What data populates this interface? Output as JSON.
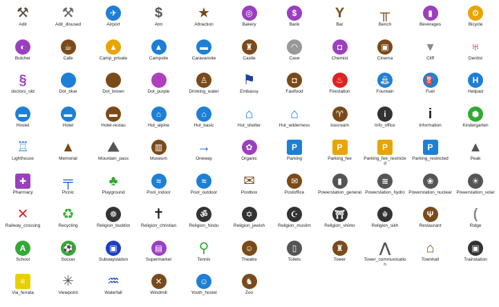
{
  "title": "",
  "icons": [
    {
      "label": "Adit",
      "color": "#5a4a3a",
      "glyph": "⚒",
      "shape": "plain"
    },
    {
      "label": "Adit_disused",
      "color": "#666666",
      "glyph": "⚒",
      "shape": "plain"
    },
    {
      "label": "Airport",
      "color": "#1e7fd6",
      "glyph": "✈",
      "shape": "circle"
    },
    {
      "label": "Atm",
      "color": "#555555",
      "glyph": "$",
      "shape": "plain"
    },
    {
      "label": "Attraction",
      "color": "#7a4a1a",
      "glyph": "★",
      "shape": "plain"
    },
    {
      "label": "Bakery",
      "color": "#9b3fbf",
      "glyph": "◎",
      "shape": "circle"
    },
    {
      "label": "Bank",
      "color": "#9b3fbf",
      "glyph": "$",
      "shape": "circle"
    },
    {
      "label": "Bar",
      "color": "#7a4a1a",
      "glyph": "Y",
      "shape": "plain"
    },
    {
      "label": "Bench",
      "color": "#7a4a1a",
      "glyph": "╥",
      "shape": "plain"
    },
    {
      "label": "Beverages",
      "color": "#9b3fbf",
      "glyph": "▮",
      "shape": "circle"
    },
    {
      "label": "Bicycle",
      "color": "#e8a400",
      "glyph": "⚙",
      "shape": "circle"
    },
    {
      "label": "Butcher",
      "color": "#9b3fbf",
      "glyph": "◐",
      "shape": "circle"
    },
    {
      "label": "Cafe",
      "color": "#7a4a1a",
      "glyph": "☕",
      "shape": "circle"
    },
    {
      "label": "Camp_private",
      "color": "#e8a400",
      "glyph": "▲",
      "shape": "circle"
    },
    {
      "label": "Campsite",
      "color": "#1e7fd6",
      "glyph": "▲",
      "shape": "circle"
    },
    {
      "label": "Caravansite",
      "color": "#1e7fd6",
      "glyph": "▬",
      "shape": "circle"
    },
    {
      "label": "Castle",
      "color": "#7a4a1a",
      "glyph": "♜",
      "shape": "circle"
    },
    {
      "label": "Cave",
      "color": "#999999",
      "glyph": "◠",
      "shape": "circle"
    },
    {
      "label": "Chemist",
      "color": "#9b3fbf",
      "glyph": "◘",
      "shape": "circle"
    },
    {
      "label": "Cinema",
      "color": "#7a4a1a",
      "glyph": "▣",
      "shape": "circle"
    },
    {
      "label": "Cliff",
      "color": "#888888",
      "glyph": "▾",
      "shape": "plain"
    },
    {
      "label": "Dentist",
      "color": "#cc2255",
      "glyph": "♅",
      "shape": "plain"
    },
    {
      "label": "doctors_old",
      "color": "#9b3fbf",
      "glyph": "§",
      "shape": "plain"
    },
    {
      "label": "Dot_blue",
      "color": "#1e7fd6",
      "glyph": "",
      "shape": "circle"
    },
    {
      "label": "Dot_brown",
      "color": "#7a4a1a",
      "glyph": "",
      "shape": "circle"
    },
    {
      "label": "Dot_purple",
      "color": "#b03fbf",
      "glyph": "",
      "shape": "circle"
    },
    {
      "label": "Drinking_water",
      "color": "#7a4a1a",
      "glyph": "♙",
      "shape": "circle"
    },
    {
      "label": "Embassy",
      "color": "#1e3f9f",
      "glyph": "⚑",
      "shape": "plain"
    },
    {
      "label": "Fastfood",
      "color": "#7a4a1a",
      "glyph": "◘",
      "shape": "circle"
    },
    {
      "label": "Firestation",
      "color": "#dd2222",
      "glyph": "♨",
      "shape": "circle"
    },
    {
      "label": "Fountain",
      "color": "#1e7fd6",
      "glyph": "⛲",
      "shape": "circle"
    },
    {
      "label": "Fuel",
      "color": "#1e7fd6",
      "glyph": "⛽",
      "shape": "circle"
    },
    {
      "label": "Helipad",
      "color": "#1e7fd6",
      "glyph": "H",
      "shape": "circle"
    },
    {
      "label": "Hostel",
      "color": "#1e7fd6",
      "glyph": "▬",
      "shape": "circle"
    },
    {
      "label": "Hotel",
      "color": "#1e7fd6",
      "glyph": "▬",
      "shape": "circle"
    },
    {
      "label": "Hotel-restau",
      "color": "#7a4a1a",
      "glyph": "▬",
      "shape": "circle"
    },
    {
      "label": "Hut_alpine",
      "color": "#1e7fd6",
      "glyph": "⌂",
      "shape": "circle"
    },
    {
      "label": "Hut_basic",
      "color": "#1e7fd6",
      "glyph": "⌂",
      "shape": "circle"
    },
    {
      "label": "Hut_shelter",
      "color": "#1e7fd6",
      "glyph": "⌂",
      "shape": "plain"
    },
    {
      "label": "Hut_wilderness",
      "color": "#1e7fd6",
      "glyph": "⌂",
      "shape": "plain"
    },
    {
      "label": "Icecream",
      "color": "#7a4a1a",
      "glyph": "♈",
      "shape": "circle"
    },
    {
      "label": "Info_office",
      "color": "#333333",
      "glyph": "i",
      "shape": "circle"
    },
    {
      "label": "Information",
      "color": "#222222",
      "glyph": "i",
      "shape": "plain"
    },
    {
      "label": "Kindergarten",
      "color": "#33aa33",
      "glyph": "⬢",
      "shape": "circle"
    },
    {
      "label": "Lighthouse",
      "color": "#1e7fd6",
      "glyph": "♖",
      "shape": "plain"
    },
    {
      "label": "Memorial",
      "color": "#7a4a1a",
      "glyph": "▲",
      "shape": "plain"
    },
    {
      "label": "Mountain_pass",
      "color": "#555555",
      "glyph": "⛰",
      "shape": "plain"
    },
    {
      "label": "Museum",
      "color": "#7a4a1a",
      "glyph": "▥",
      "shape": "circle"
    },
    {
      "label": "Oneway",
      "color": "#1e5fd6",
      "glyph": "→",
      "shape": "plain"
    },
    {
      "label": "Organic",
      "color": "#9b3fbf",
      "glyph": "✿",
      "shape": "circle"
    },
    {
      "label": "Parking",
      "color": "#1e7fd6",
      "glyph": "P",
      "shape": "sq"
    },
    {
      "label": "Parking_fee",
      "color": "#e8a400",
      "glyph": "P",
      "shape": "sq"
    },
    {
      "label": "Parking_fee_restricted",
      "color": "#e8a400",
      "glyph": "P",
      "shape": "sq"
    },
    {
      "label": "Parking_restricted",
      "color": "#1e7fd6",
      "glyph": "P",
      "shape": "sq"
    },
    {
      "label": "Peak",
      "color": "#555555",
      "glyph": "▲",
      "shape": "plain"
    },
    {
      "label": "Pharmacy",
      "color": "#9b3fbf",
      "glyph": "✚",
      "shape": "sq"
    },
    {
      "label": "Picnic",
      "color": "#1e5fd6",
      "glyph": "╤",
      "shape": "plain"
    },
    {
      "label": "Playground",
      "color": "#33aa33",
      "glyph": "♣",
      "shape": "plain"
    },
    {
      "label": "Pool_indoor",
      "color": "#1e7fd6",
      "glyph": "≈",
      "shape": "circle"
    },
    {
      "label": "Pool_outdoor",
      "color": "#1e7fd6",
      "glyph": "≈",
      "shape": "circle"
    },
    {
      "label": "Postbox",
      "color": "#7a4a1a",
      "glyph": "✉",
      "shape": "plain"
    },
    {
      "label": "Postoffice",
      "color": "#7a4a1a",
      "glyph": "✉",
      "shape": "circle"
    },
    {
      "label": "Powerstation_general",
      "color": "#555555",
      "glyph": "▮",
      "shape": "circle"
    },
    {
      "label": "Powerstation_hydro",
      "color": "#555555",
      "glyph": "≋",
      "shape": "circle"
    },
    {
      "label": "Powerstation_nuclear",
      "color": "#555555",
      "glyph": "❀",
      "shape": "circle"
    },
    {
      "label": "Powerstation_solar",
      "color": "#555555",
      "glyph": "☀",
      "shape": "circle"
    },
    {
      "label": "Railway_crossing",
      "color": "#dd2222",
      "glyph": "✕",
      "shape": "plain"
    },
    {
      "label": "Recycling",
      "color": "#33aa33",
      "glyph": "♻",
      "shape": "plain"
    },
    {
      "label": "Religion_buddist",
      "color": "#333333",
      "glyph": "☸",
      "shape": "circle"
    },
    {
      "label": "Religion_christian",
      "color": "#222222",
      "glyph": "✝",
      "shape": "plain"
    },
    {
      "label": "Religion_hindu",
      "color": "#333333",
      "glyph": "ॐ",
      "shape": "circle"
    },
    {
      "label": "Religion_jewish",
      "color": "#333333",
      "glyph": "✡",
      "shape": "circle"
    },
    {
      "label": "Religion_muslim",
      "color": "#333333",
      "glyph": "☪",
      "shape": "circle"
    },
    {
      "label": "Religion_shinto",
      "color": "#333333",
      "glyph": "⛩",
      "shape": "circle"
    },
    {
      "label": "Religion_sikh",
      "color": "#333333",
      "glyph": "☬",
      "shape": "circle"
    },
    {
      "label": "Restaurant",
      "color": "#7a4a1a",
      "glyph": "Ψ",
      "shape": "circle"
    },
    {
      "label": "Ridge",
      "color": "#888888",
      "glyph": "(",
      "shape": "plain"
    },
    {
      "label": "School",
      "color": "#33aa33",
      "glyph": "A",
      "shape": "circle"
    },
    {
      "label": "Soccer",
      "color": "#33aa33",
      "glyph": "⚽",
      "shape": "circle"
    },
    {
      "label": "Subwaystation",
      "color": "#1e3fbf",
      "glyph": "▣",
      "shape": "circle"
    },
    {
      "label": "Supermarket",
      "color": "#9b3fbf",
      "glyph": "▤",
      "shape": "circle"
    },
    {
      "label": "Tennis",
      "color": "#33aa33",
      "glyph": "⚲",
      "shape": "plain"
    },
    {
      "label": "Theatre",
      "color": "#7a4a1a",
      "glyph": "☺",
      "shape": "circle"
    },
    {
      "label": "Toilets",
      "color": "#555555",
      "glyph": "▯",
      "shape": "circle"
    },
    {
      "label": "Tower",
      "color": "#7a4a1a",
      "glyph": "♜",
      "shape": "circle"
    },
    {
      "label": "Tower_communication",
      "color": "#555555",
      "glyph": "⋀",
      "shape": "plain"
    },
    {
      "label": "Townhall",
      "color": "#7a4a1a",
      "glyph": "⌂",
      "shape": "plain"
    },
    {
      "label": "Trainstation",
      "color": "#333333",
      "glyph": "▣",
      "shape": "circle"
    },
    {
      "label": "Via_ferrata",
      "color": "#e8d000",
      "glyph": "≡",
      "shape": "sq"
    },
    {
      "label": "Viewpoint",
      "color": "#555555",
      "glyph": "✳",
      "shape": "plain"
    },
    {
      "label": "Waterfall",
      "color": "#1e3fbf",
      "glyph": "♒",
      "shape": "plain"
    },
    {
      "label": "Windmill",
      "color": "#7a4a1a",
      "glyph": "✕",
      "shape": "circle"
    },
    {
      "label": "Youth_hostel",
      "color": "#1e7fd6",
      "glyph": "☺",
      "shape": "circle"
    },
    {
      "label": "Zoo",
      "color": "#7a4a1a",
      "glyph": "♞",
      "shape": "circle"
    }
  ]
}
